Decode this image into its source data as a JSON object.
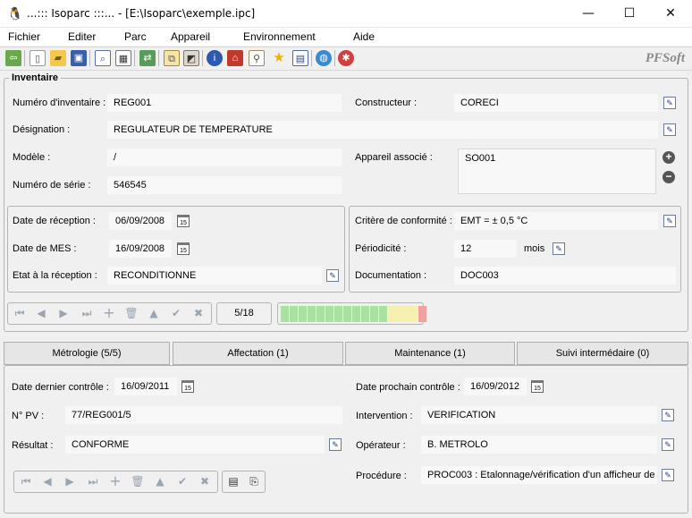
{
  "window": {
    "title": "...::: Isoparc :::... - [E:\\Isoparc\\exemple.ipc]",
    "minimize_glyph": "—",
    "maximize_glyph": "☐",
    "close_glyph": "✕"
  },
  "menu": [
    "Fichier",
    "Editer",
    "Parc",
    "Appareil",
    "Environnement",
    "Aide"
  ],
  "toolbar": {
    "brand": "PFSoft",
    "icons": [
      "exit-icon",
      "new-icon",
      "open-icon",
      "save-icon",
      "preview-icon",
      "report-icon",
      "transfer-icon",
      "copy-icon",
      "filter-icon",
      "info-icon",
      "home-icon",
      "search-icon",
      "favorite-icon",
      "calculator-icon",
      "globe-icon",
      "bug-icon"
    ]
  },
  "inventaire": {
    "title": "Inventaire",
    "num_inv_label": "Numéro d'inventaire :",
    "num_inv_value": "REG001",
    "designation_label": "Désignation :",
    "designation_value": "REGULATEUR DE TEMPERATURE",
    "modele_label": "Modèle :",
    "modele_value": "/",
    "num_serie_label": "Numéro de série :",
    "num_serie_value": "546545",
    "constructeur_label": "Constructeur :",
    "constructeur_value": "CORECI",
    "appareil_assoc_label": "Appareil associé :",
    "appareil_assoc_value": "SO001",
    "date_reception_label": "Date de réception :",
    "date_reception_value": "06/09/2008",
    "date_mes_label": "Date de MES :",
    "date_mes_value": "16/09/2008",
    "etat_reception_label": "Etat à la réception :",
    "etat_reception_value": "RECONDITIONNE",
    "critere_label": "Critère de conformité :",
    "critere_value": "EMT = ± 0,5 °C",
    "periodicite_label": "Périodicité :",
    "periodicite_value": "12",
    "periodicite_unit": "mois",
    "documentation_label": "Documentation :",
    "documentation_value": "DOC003",
    "calendar_glyph": "15"
  },
  "record_nav": {
    "position": "5/18",
    "progress_segments": [
      "#a9e2a0",
      "#a9e2a0",
      "#a9e2a0",
      "#a9e2a0",
      "#a9e2a0",
      "#a9e2a0",
      "#a9e2a0",
      "#a9e2a0",
      "#a9e2a0",
      "#a9e2a0",
      "#a9e2a0",
      "#a9e2a0",
      "#f5f0b0",
      "#f5f0b0",
      "#f5f0b0",
      "#f0a0a0"
    ]
  },
  "tabs": [
    {
      "label": "Métrologie (5/5)",
      "active": true
    },
    {
      "label": "Affectation (1)",
      "active": false
    },
    {
      "label": "Maintenance (1)",
      "active": false
    },
    {
      "label": "Suivi intermédaire (0)",
      "active": false
    }
  ],
  "metrologie": {
    "date_dernier_label": "Date dernier contrôle :",
    "date_dernier_value": "16/09/2011",
    "date_prochain_label": "Date prochain contrôle :",
    "date_prochain_value": "16/09/2012",
    "npv_label": "N° PV :",
    "npv_value": "77/REG001/5",
    "intervention_label": "Intervention :",
    "intervention_value": "VERIFICATION",
    "resultat_label": "Résultat :",
    "resultat_value": "CONFORME",
    "operateur_label": "Opérateur :",
    "operateur_value": "B. METROLO",
    "procedure_label": "Procédure :",
    "procedure_value": "PROC003 : Etalonnage/vérification d'un afficheur de t"
  }
}
